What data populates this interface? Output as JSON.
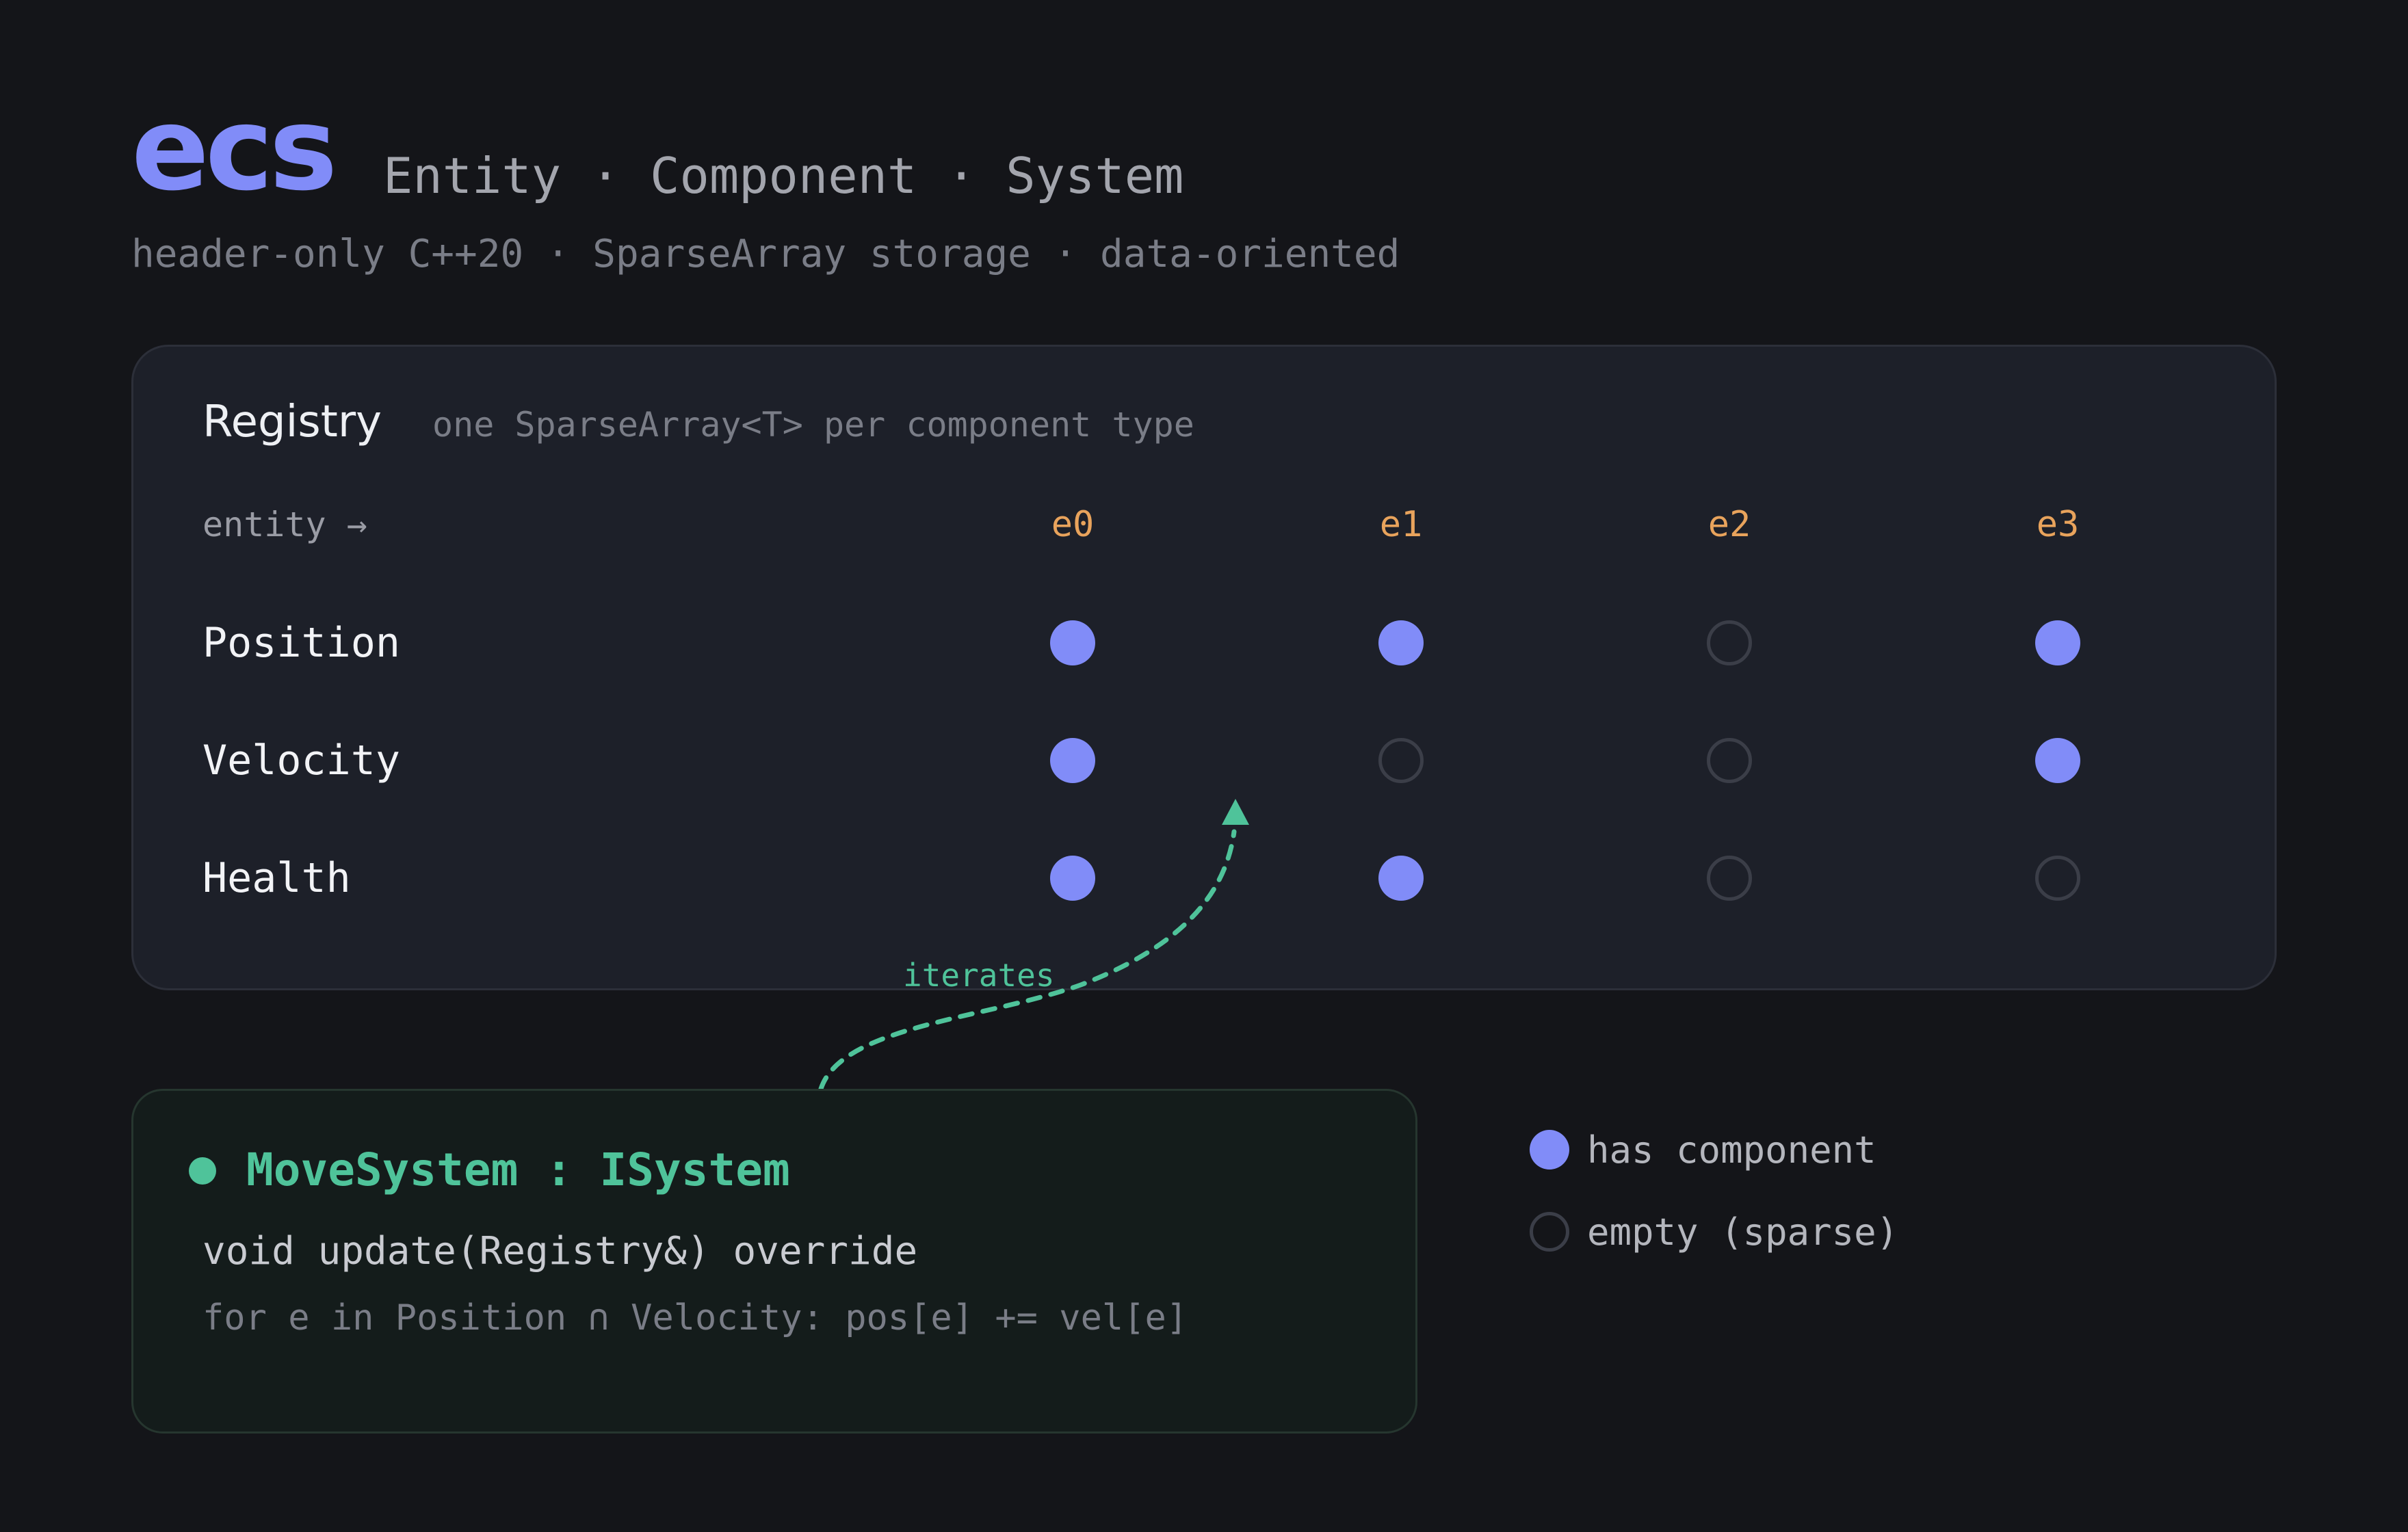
{
  "header": {
    "logo": "ecs",
    "tagline": "Entity · Component · System",
    "subtitle": "header-only C++20 · SparseArray storage · data-oriented"
  },
  "registry": {
    "title": "Registry",
    "subtitle": "one SparseArray<T> per component type",
    "entity_axis_label": "entity →",
    "entities": [
      "e0",
      "e1",
      "e2",
      "e3"
    ],
    "components": [
      {
        "name": "Position",
        "has": [
          true,
          true,
          false,
          true
        ]
      },
      {
        "name": "Velocity",
        "has": [
          true,
          false,
          false,
          true
        ]
      },
      {
        "name": "Health",
        "has": [
          true,
          true,
          false,
          false
        ]
      }
    ]
  },
  "arrow": {
    "label": "iterates"
  },
  "system": {
    "title": "MoveSystem : ISystem",
    "signature": "void update(Registry&) override",
    "body": "for e in Position ∩ Velocity: pos[e] += vel[e]"
  },
  "legend": {
    "has_component": "has component",
    "empty": "empty (sparse)"
  },
  "colors": {
    "background": "#141519",
    "accent": "#818cf8",
    "entity": "#e8a35c",
    "system": "#4fc39a",
    "empty_ring": "#3b3e48"
  }
}
